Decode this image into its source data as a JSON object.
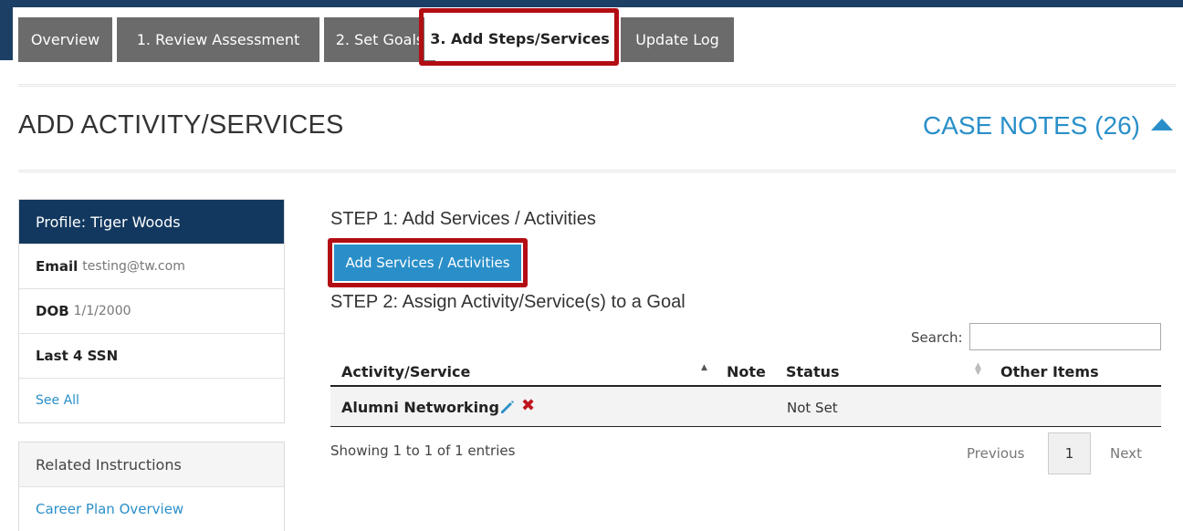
{
  "tabs": [
    {
      "label": "Overview"
    },
    {
      "label": "1. Review Assessment"
    },
    {
      "label": "2. Set Goals"
    },
    {
      "label": "3. Add Steps/Services",
      "active": true
    },
    {
      "label": "Update Log"
    }
  ],
  "page": {
    "title": "ADD ACTIVITY/SERVICES",
    "case_notes": "CASE NOTES (26)"
  },
  "profile": {
    "header": "Profile: Tiger Woods",
    "email_label": "Email",
    "email_value": "testing@tw.com",
    "dob_label": "DOB",
    "dob_value": "1/1/2000",
    "ssn_label": "Last 4 SSN",
    "see_all": "See All"
  },
  "related": {
    "header": "Related Instructions",
    "link": "Career Plan Overview"
  },
  "steps": {
    "step1": "STEP 1: Add Services / Activities",
    "add_button": "Add Services / Activities",
    "step2": "STEP 2: Assign Activity/Service(s) to a Goal"
  },
  "table": {
    "search_label": "Search:",
    "search_value": "",
    "columns": [
      "Activity/Service",
      "Note",
      "Status",
      "Other Items"
    ],
    "rows": [
      {
        "activity": "Alumni Networking",
        "note": "",
        "status": "Not Set",
        "other": ""
      }
    ],
    "info": "Showing 1 to 1 of 1 entries",
    "previous": "Previous",
    "current_page": "1",
    "next": "Next"
  },
  "colors": {
    "navy": "#12385f",
    "accent_blue": "#2a8fc9",
    "highlight_red": "#b30d14",
    "delete_red": "#c0161e"
  },
  "icons": [
    "caret-up-icon",
    "pencil-icon",
    "delete-x-icon",
    "sort-asc-icon",
    "sort-both-icon"
  ]
}
